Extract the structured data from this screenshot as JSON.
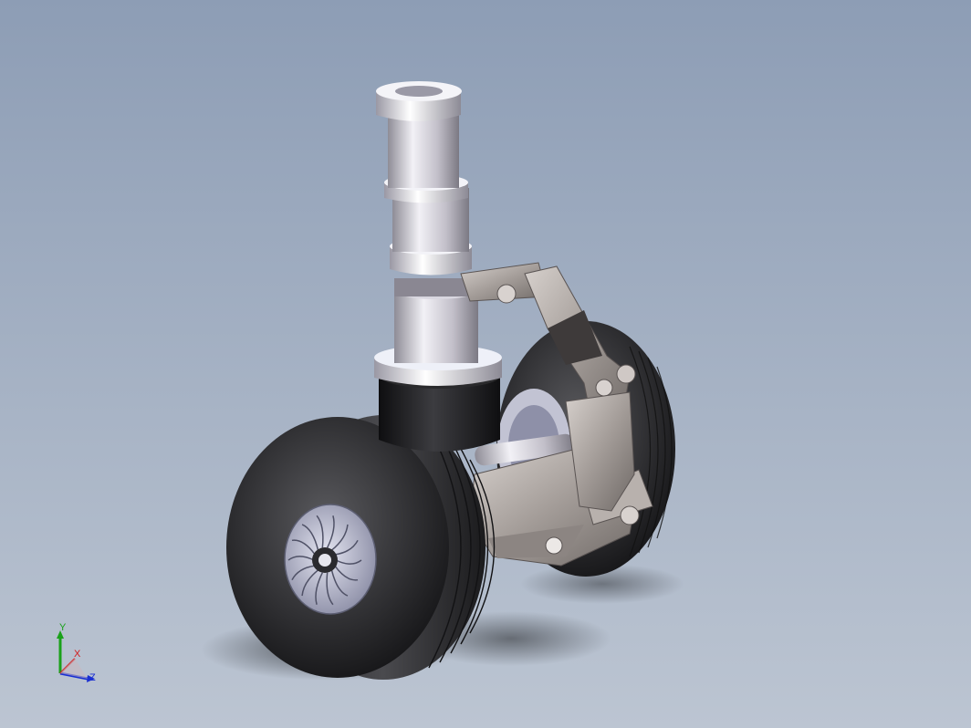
{
  "viewport": {
    "background_top": "#8d9db5",
    "background_bottom": "#bcc5d2"
  },
  "model": {
    "colors": {
      "strut_metal": "#c9c6cf",
      "tire": "#2a2a2c",
      "hub_rubber": "#1c1c1e",
      "linkage": "#a19a98",
      "wheel_rim": "#b3b4c6"
    }
  },
  "triad": {
    "x_label": "X",
    "y_label": "Y",
    "z_label": "Z",
    "x_color": "#d21a1a",
    "y_color": "#1aa11a",
    "z_color": "#1a2fd2"
  }
}
